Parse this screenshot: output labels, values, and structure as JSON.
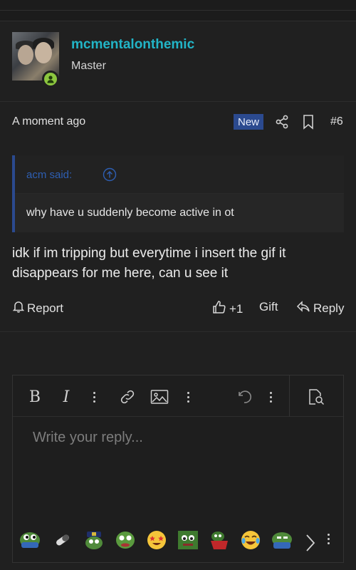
{
  "post": {
    "username": "mcmentalonthemic",
    "user_title": "Master",
    "timestamp": "A moment ago",
    "badge": "New",
    "post_number": "#6",
    "quote": {
      "author": "acm said:",
      "text": "why have u suddenly become active in ot"
    },
    "message": "idk if im tripping but everytime i insert the gif it disappears for me here, can u see it",
    "actions": {
      "report": "Report",
      "like": "+1",
      "gift": "Gift",
      "reply": "Reply"
    }
  },
  "editor": {
    "placeholder": "Write your reply...",
    "toolbar": {
      "bold": "B",
      "italic": "I"
    }
  },
  "colors": {
    "accent": "#22b5c7",
    "online": "#8cc63f",
    "new_badge": "#2b4a8f",
    "background": "#202020"
  },
  "icons": [
    "share-icon",
    "bookmark-icon",
    "bell-icon",
    "thumbs-up-icon",
    "reply-arrow-icon",
    "link-icon",
    "image-icon",
    "undo-icon",
    "preview-icon",
    "chevron-right-icon",
    "more-vertical-icon"
  ]
}
